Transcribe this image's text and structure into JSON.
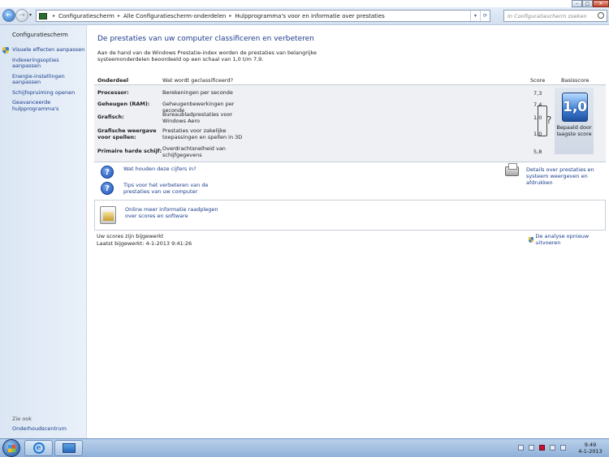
{
  "window": {
    "minimize": "–",
    "maximize": "□",
    "close": "×"
  },
  "nav": {
    "back_icon": "←",
    "forward_icon": "→",
    "dropdown_icon": "▾"
  },
  "address": {
    "crumbs": [
      "Configuratiescherm",
      "Alle Configuratiescherm-onderdelen",
      "Hulpprogramma's voor en informatie over prestaties"
    ],
    "separator": "▸",
    "dropdown_icon": "▾",
    "refresh_icon": "⟳"
  },
  "search": {
    "placeholder": "In Configuratiescherm zoeken"
  },
  "sidebar": {
    "home": "Configuratiescherm",
    "links": [
      "Visuele effecten aanpassen",
      "Indexeringsopties aanpassen",
      "Energie-instellingen aanpassen",
      "Schijfopruiming openen",
      "Geavanceerde hulpprogramma's"
    ],
    "see_also": "Zie ook",
    "action_center": "Onderhoudscentrum"
  },
  "help_icon": "?",
  "main": {
    "title": "De prestaties van uw computer classificeren en verbeteren",
    "intro": "Aan de hand van de Windows Prestatie-index worden de prestaties van belangrijke systeemonderdelen beoordeeld op een schaal van 1,0 t/m 7,9.",
    "table": {
      "headers": {
        "component": "Onderdeel",
        "what": "Wat wordt geclassificeerd?",
        "score": "Score",
        "base": "Basisscore"
      },
      "rows": [
        {
          "component": "Processor:",
          "what": "Berekeningen per seconde",
          "score": "7,3"
        },
        {
          "component": "Geheugen (RAM):",
          "what": "Geheugenbewerkingen per seconde",
          "score": "7,4"
        },
        {
          "component": "Grafisch:",
          "what": "Bureaubladprestaties voor Windows Aero",
          "score": "1,0"
        },
        {
          "component": "Grafische weergave voor spellen:",
          "what": "Prestaties voor zakelijke toepassingen en spellen in 3D",
          "score": "1,0"
        },
        {
          "component": "Primaire harde schijf:",
          "what": "Overdrachtsnelheid van schijfgegevens",
          "score": "5,8"
        }
      ],
      "base_score": "1,0",
      "base_label": "Bepaald door laagste score",
      "bracket_mark": "?"
    },
    "help_links": [
      {
        "icon": "?",
        "label": "Wat houden deze cijfers in?"
      },
      {
        "icon": "?",
        "label": "Tips voor het verbeteren van de prestaties van uw computer"
      }
    ],
    "details_link": "Details over prestaties en systeem weergeven en afdrukken",
    "online_link": "Online meer informatie raadplegen over scores en software",
    "status": "Uw scores zijn bijgewerkt",
    "last_updated": "Laatst bijgewerkt: 4-1-2013 9:41:26",
    "rerun": "De analyse opnieuw uitvoeren"
  },
  "taskbar": {
    "ie_glyph": "e",
    "time": "9:49",
    "date": "4-1-2013"
  }
}
